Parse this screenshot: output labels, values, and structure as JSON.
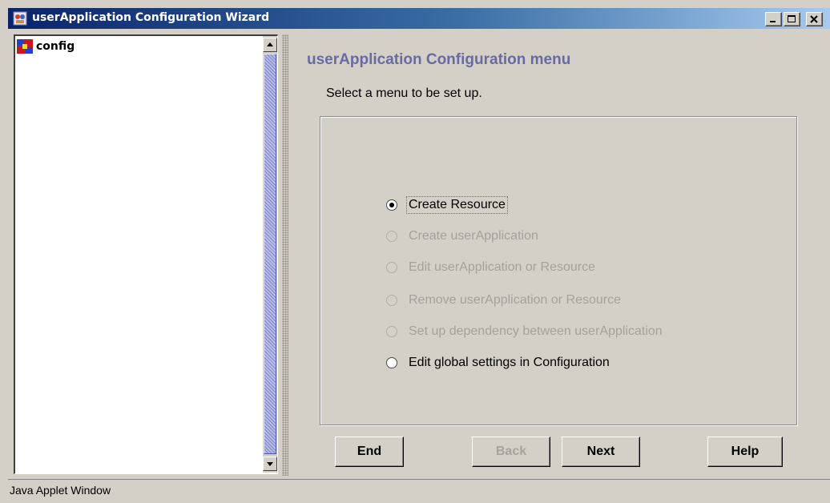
{
  "window": {
    "title": "userApplication Configuration Wizard",
    "app_icon": "java-applet-icon",
    "controls": [
      "minimize-icon",
      "maximize-icon",
      "close-icon"
    ]
  },
  "tree": {
    "root_label": "config",
    "root_icon": "config-tree-icon"
  },
  "main": {
    "title": "userApplication Configuration menu",
    "instruction": "Select a menu to be set up.",
    "options": [
      {
        "label": "Create Resource",
        "selected": true,
        "enabled": true
      },
      {
        "label": "Create userApplication",
        "selected": false,
        "enabled": false
      },
      {
        "label": "Edit userApplication or Resource",
        "selected": false,
        "enabled": false
      },
      {
        "label": "Remove userApplication or Resource",
        "selected": false,
        "enabled": false
      },
      {
        "label": "Set up dependency between userApplication",
        "selected": false,
        "enabled": false
      },
      {
        "label": "Edit global settings in Configuration",
        "selected": false,
        "enabled": true
      }
    ]
  },
  "buttons": {
    "end": "End",
    "back": "Back",
    "next": "Next",
    "help": "Help"
  },
  "status": {
    "text": "Java Applet Window"
  },
  "colors": {
    "title_gradient_start": "#0a246a",
    "title_gradient_end": "#a6caf0",
    "menu_title": "#6a6aa2",
    "face": "#d4d0c8",
    "disabled_text": "#a3a29c"
  }
}
